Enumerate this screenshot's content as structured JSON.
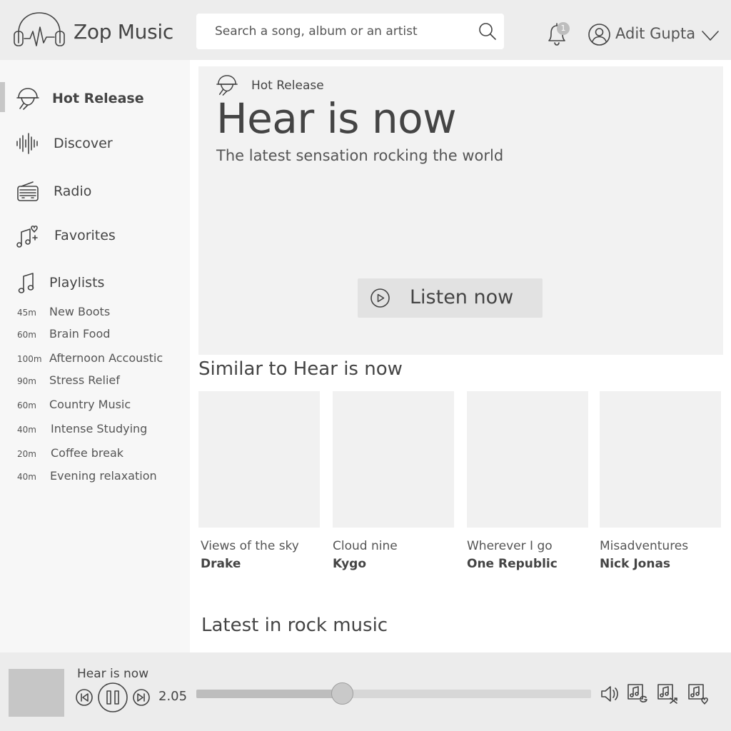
{
  "app": {
    "name": "Zop Music"
  },
  "search": {
    "placeholder": "Search a song, album or an artist",
    "value": ""
  },
  "header": {
    "notification_count": "1",
    "user_name": "Adit Gupta"
  },
  "sidebar": {
    "items": [
      {
        "label": "Hot Release",
        "icon": "hot-release-icon",
        "active": true
      },
      {
        "label": "Discover",
        "icon": "soundwave-icon",
        "active": false
      },
      {
        "label": "Radio",
        "icon": "radio-icon",
        "active": false
      },
      {
        "label": "Favorites",
        "icon": "music-heart-icon",
        "active": false
      },
      {
        "label": "Playlists",
        "icon": "music-note-icon",
        "active": false
      }
    ],
    "playlists": [
      {
        "duration": "45m",
        "name": "New Boots"
      },
      {
        "duration": "60m",
        "name": "Brain Food"
      },
      {
        "duration": "100m",
        "name": "Afternoon Accoustic"
      },
      {
        "duration": "90m",
        "name": "Stress Relief"
      },
      {
        "duration": "60m",
        "name": "Country Music"
      },
      {
        "duration": "40m",
        "name": "Intense Studying"
      },
      {
        "duration": "20m",
        "name": "Coffee break"
      },
      {
        "duration": "40m",
        "name": "Evening relaxation"
      }
    ]
  },
  "hero": {
    "tag": "Hot Release",
    "title": "Hear is now",
    "subtitle": "The latest sensation rocking the world",
    "cta_label": "Listen now"
  },
  "similar": {
    "title": "Similar to Hear is now",
    "cards": [
      {
        "song": "Views of the sky",
        "artist": "Drake"
      },
      {
        "song": "Cloud nine",
        "artist": "Kygo"
      },
      {
        "song": "Wherever I go",
        "artist": "One Republic"
      },
      {
        "song": "Misadventures",
        "artist": "Nick Jonas"
      }
    ]
  },
  "latest": {
    "title": "Latest in rock music"
  },
  "player": {
    "title": "Hear is now",
    "time": "2.05",
    "progress": 0.37,
    "colors": {
      "track": "#d7d7d7",
      "fill": "#bdbdbd",
      "knob": "#c9c9c9"
    }
  }
}
